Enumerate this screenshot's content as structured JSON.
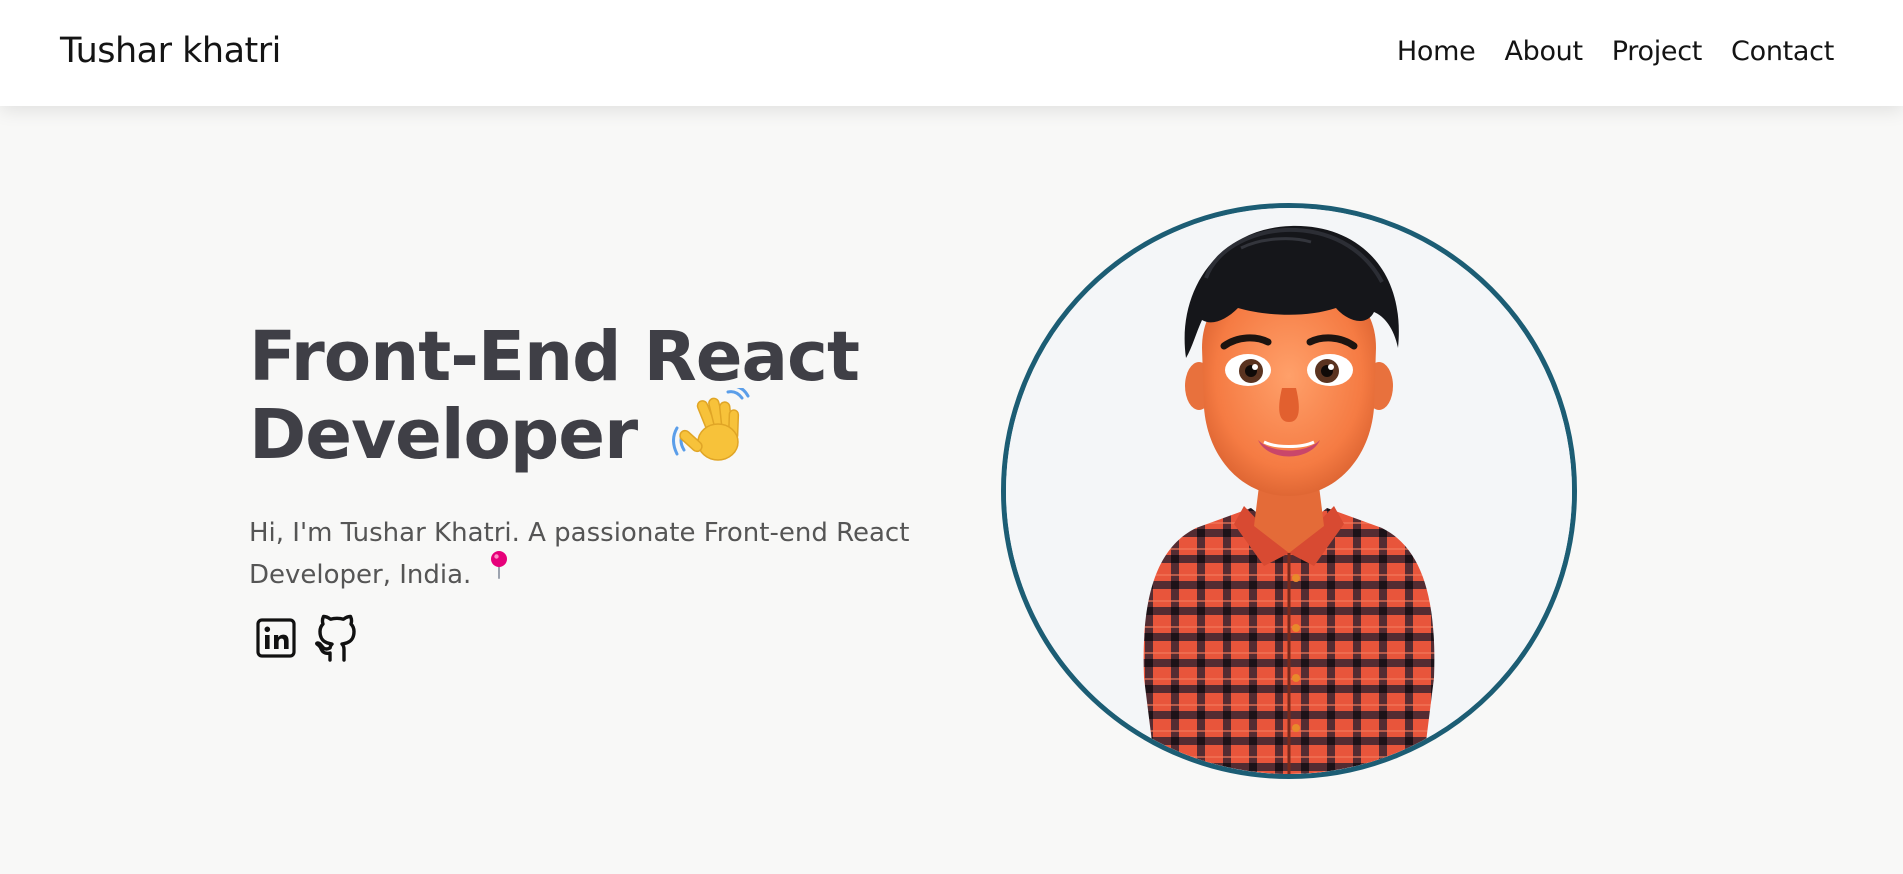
{
  "navbar": {
    "brand": "Tushar khatri",
    "links": [
      "Home",
      "About",
      "Project",
      "Contact"
    ]
  },
  "hero": {
    "headline_line1": "Front-End React",
    "headline_line2": "Developer",
    "description": "Hi, I'm Tushar Khatri. A passionate Front-end React Developer, India.",
    "icons": {
      "wave": "waving-hand-icon",
      "pin": "round-pushpin-icon",
      "linkedin": "linkedin-icon",
      "github": "github-icon"
    }
  },
  "colors": {
    "ring": "#1c5d74",
    "heading": "#3f3f46",
    "background": "#f8f8f7"
  }
}
